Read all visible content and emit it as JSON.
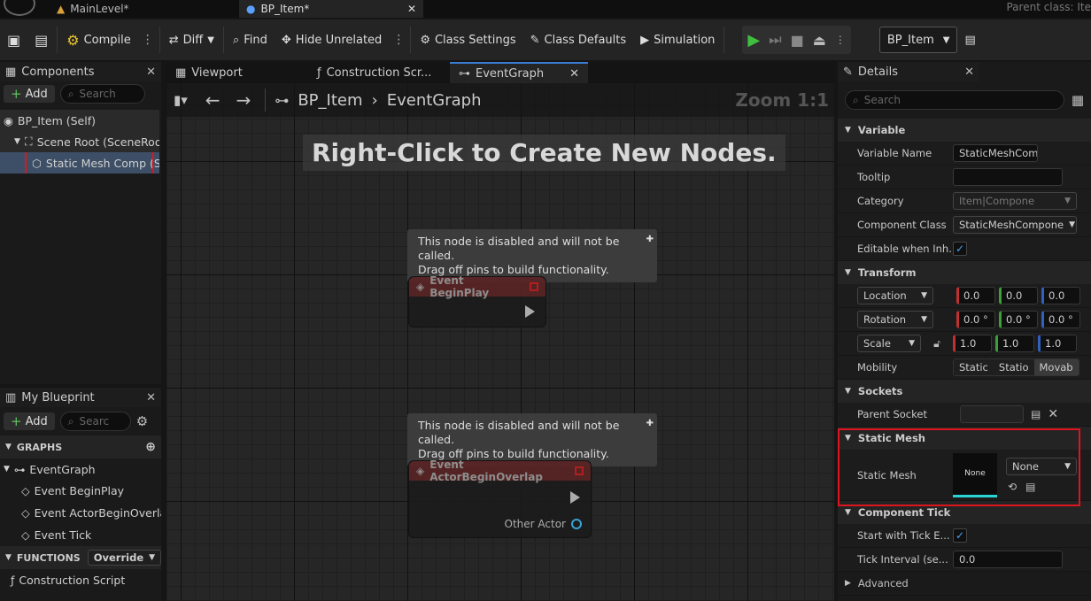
{
  "tabs": {
    "level": "MainLevel*",
    "blueprint": "BP_Item*",
    "close": "✕",
    "parent_class": "Parent class: Ite"
  },
  "toolbar": {
    "compile": "Compile",
    "diff": "Diff",
    "find": "Find",
    "hide_unrelated": "Hide Unrelated",
    "class_settings": "Class Settings",
    "class_defaults": "Class Defaults",
    "simulation": "Simulation",
    "debug_object": "BP_Item"
  },
  "components": {
    "title": "Components",
    "add": "Add",
    "search_placeholder": "Search",
    "items": [
      "BP_Item (Self)",
      "Scene Root (SceneRoot)",
      "Static Mesh Comp (StaticMeshComponent)"
    ]
  },
  "my_blueprint": {
    "title": "My Blueprint",
    "add": "Add",
    "search_placeholder": "Searc",
    "graphs_label": "GRAPHS",
    "event_graph": "EventGraph",
    "events": [
      "Event BeginPlay",
      "Event ActorBeginOverla",
      "Event Tick"
    ],
    "functions_label": "FUNCTIONS",
    "override": "Override",
    "construction_script": "Construction Script"
  },
  "graph": {
    "tabs": [
      "Viewport",
      "Construction Scr...",
      "EventGraph"
    ],
    "breadcrumb_root": "BP_Item",
    "breadcrumb_graph": "EventGraph",
    "zoom": "Zoom 1:1",
    "hint": "Right-Click to Create New Nodes.",
    "disabled_line1": "This node is disabled and will not be called.",
    "disabled_line2": "Drag off pins to build functionality.",
    "node1": "Event BeginPlay",
    "node2": "Event ActorBeginOverlap",
    "node2_pin": "Other Actor"
  },
  "details": {
    "title": "Details",
    "search_placeholder": "Search",
    "variable": {
      "section": "Variable",
      "name_label": "Variable Name",
      "name_value": "StaticMeshComp",
      "tooltip_label": "Tooltip",
      "category_label": "Category",
      "category_value": "Item|Compone",
      "class_label": "Component Class",
      "class_value": "StaticMeshCompone",
      "editable_label": "Editable when Inh..."
    },
    "transform": {
      "section": "Transform",
      "location": "Location",
      "rotation": "Rotation",
      "scale": "Scale",
      "loc": [
        "0.0",
        "0.0",
        "0.0"
      ],
      "rot": [
        "0.0 °",
        "0.0 °",
        "0.0 °"
      ],
      "scl": [
        "1.0",
        "1.0",
        "1.0"
      ],
      "mobility_label": "Mobility",
      "mobility": [
        "Static",
        "Statio",
        "Movab"
      ]
    },
    "sockets": {
      "section": "Sockets",
      "parent_label": "Parent Socket"
    },
    "static_mesh": {
      "section": "Static Mesh",
      "label": "Static Mesh",
      "thumb": "None",
      "value": "None"
    },
    "tick": {
      "section": "Component Tick",
      "start_label": "Start with Tick E...",
      "interval_label": "Tick Interval (se...",
      "interval_value": "0.0"
    },
    "advanced": "Advanced"
  },
  "colors": {
    "highlight": "#e0141e",
    "accent": "#3a7bd5",
    "play": "#3fbf3f"
  }
}
